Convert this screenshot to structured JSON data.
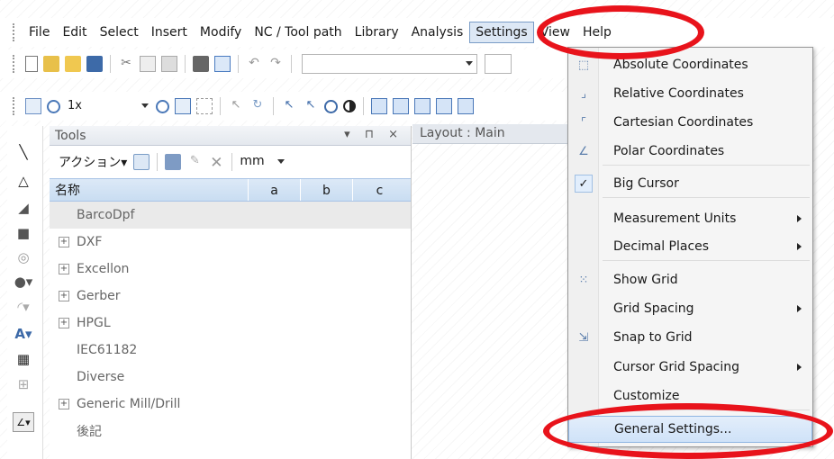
{
  "menubar": {
    "items": [
      "File",
      "Edit",
      "Select",
      "Insert",
      "Modify",
      "NC / Tool path",
      "Library",
      "Analysis",
      "Settings",
      "View",
      "Help"
    ]
  },
  "toolbar2": {
    "zoom": "1x"
  },
  "tools_panel": {
    "title": "Tools",
    "controls": "▾ ⊓ ×",
    "action_label": "アクション▾",
    "unit": "mm",
    "columns": [
      "名称",
      "a",
      "b",
      "c"
    ],
    "rows": [
      {
        "name": "BarcoDpf",
        "expand": false,
        "selected": true
      },
      {
        "name": "DXF",
        "expand": true
      },
      {
        "name": "Excellon",
        "expand": true
      },
      {
        "name": "Gerber",
        "expand": true
      },
      {
        "name": "HPGL",
        "expand": true
      },
      {
        "name": "IEC61182",
        "expand": false
      },
      {
        "name": "Diverse",
        "expand": false
      },
      {
        "name": "Generic Mill/Drill",
        "expand": true
      },
      {
        "name": "後記",
        "expand": false
      }
    ]
  },
  "layout_tab": {
    "title": "Layout : Main"
  },
  "settings_menu": {
    "items": [
      {
        "label": "Absolute Coordinates",
        "icon": "absolute-coordinates-icon"
      },
      {
        "label": "Relative Coordinates",
        "icon": "relative-coordinates-icon"
      },
      {
        "label": "Cartesian Coordinates",
        "icon": "cartesian-coordinates-icon"
      },
      {
        "label": "Polar Coordinates",
        "icon": "polar-coordinates-icon"
      },
      {
        "label": "Big Cursor",
        "checked": true
      },
      {
        "label": "Measurement Units",
        "submenu": true
      },
      {
        "label": "Decimal Places",
        "submenu": true
      },
      {
        "label": "Show Grid",
        "icon": "grid-icon"
      },
      {
        "label": "Grid Spacing",
        "submenu": true
      },
      {
        "label": "Snap to Grid",
        "icon": "snap-grid-icon"
      },
      {
        "label": "Cursor Grid Spacing",
        "submenu": true
      },
      {
        "label": "Customize"
      },
      {
        "label": "General Settings...",
        "highlighted": true
      }
    ]
  },
  "annotation_color": "#e8131b"
}
